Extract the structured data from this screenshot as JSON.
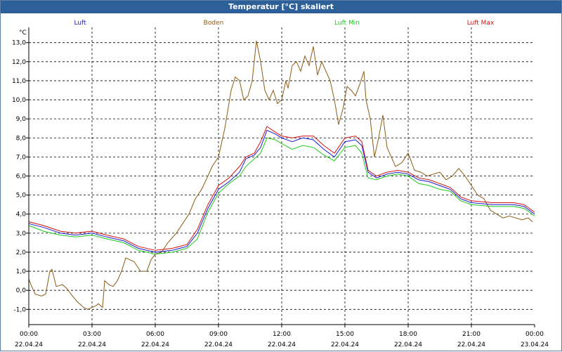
{
  "window": {
    "title": "Temperatur [°C] skaliert"
  },
  "chart_data": {
    "type": "line",
    "title": "Temperatur [°C] skaliert",
    "ylabel": "°C",
    "xlim": [
      0,
      24
    ],
    "ylim": [
      -1.8,
      13.8
    ],
    "y_ticks": [
      "-1,0",
      "0,0",
      "1,0",
      "2,0",
      "3,0",
      "4,0",
      "5,0",
      "6,0",
      "7,0",
      "8,0",
      "9,0",
      "10,0",
      "11,0",
      "12,0",
      "13,0"
    ],
    "y_tick_values": [
      -1,
      0,
      1,
      2,
      3,
      4,
      5,
      6,
      7,
      8,
      9,
      10,
      11,
      12,
      13
    ],
    "x_ticks": [
      {
        "time": "00:00",
        "date": "22.04.24"
      },
      {
        "time": "03:00",
        "date": "22.04.24"
      },
      {
        "time": "06:00",
        "date": "22.04.24"
      },
      {
        "time": "09:00",
        "date": "22.04.24"
      },
      {
        "time": "12:00",
        "date": "22.04.24"
      },
      {
        "time": "15:00",
        "date": "22.04.24"
      },
      {
        "time": "18:00",
        "date": "22.04.24"
      },
      {
        "time": "21:00",
        "date": "22.04.24"
      },
      {
        "time": "00:00",
        "date": "23.04.24"
      }
    ],
    "x_tick_values": [
      0,
      3,
      6,
      9,
      12,
      15,
      18,
      21,
      24
    ],
    "grid": true,
    "legend_position": "top",
    "series": [
      {
        "name": "Boden",
        "color": "#8b5a14",
        "x": [
          0,
          0.1,
          0.3,
          0.6,
          0.8,
          1.0,
          1.1,
          1.3,
          1.6,
          1.8,
          2.0,
          2.3,
          2.6,
          2.8,
          3.0,
          3.2,
          3.3,
          3.5,
          3.6,
          3.8,
          4.0,
          4.2,
          4.4,
          4.6,
          5.0,
          5.3,
          5.6,
          5.8,
          6.0,
          6.3,
          6.6,
          7.0,
          7.3,
          7.6,
          7.9,
          8.2,
          8.5,
          8.7,
          9.0,
          9.3,
          9.6,
          9.8,
          10.0,
          10.2,
          10.4,
          10.6,
          10.8,
          11.0,
          11.2,
          11.4,
          11.6,
          11.8,
          12.0,
          12.2,
          12.3,
          12.5,
          12.7,
          12.9,
          13.1,
          13.3,
          13.5,
          13.7,
          13.9,
          14.1,
          14.3,
          14.5,
          14.7,
          14.9,
          15.1,
          15.3,
          15.5,
          15.7,
          15.9,
          16.0,
          16.2,
          16.4,
          16.6,
          16.8,
          17.0,
          17.2,
          17.4,
          17.7,
          18.0,
          18.3,
          18.6,
          18.9,
          19.2,
          19.5,
          19.8,
          20.1,
          20.4,
          20.7,
          21.0,
          21.3,
          21.6,
          21.9,
          22.2,
          22.5,
          22.8,
          23.1,
          23.4,
          23.7,
          23.9
        ],
        "y": [
          0.6,
          0.3,
          -0.2,
          -0.3,
          -0.2,
          1.0,
          1.1,
          0.2,
          0.3,
          0.1,
          -0.2,
          -0.6,
          -0.9,
          -1.0,
          -0.9,
          -0.8,
          -0.7,
          -0.9,
          0.5,
          0.3,
          0.2,
          0.5,
          1.0,
          1.7,
          1.5,
          1.0,
          1.0,
          1.6,
          1.9,
          2.0,
          2.5,
          3.0,
          3.5,
          4.0,
          4.8,
          5.3,
          6.0,
          6.5,
          7.0,
          8.5,
          10.5,
          11.2,
          11.0,
          10.0,
          10.2,
          11.0,
          13.1,
          12.0,
          10.5,
          10.0,
          10.5,
          9.8,
          10.0,
          11.0,
          10.6,
          11.8,
          12.0,
          11.5,
          12.3,
          11.8,
          12.8,
          11.3,
          12.0,
          11.5,
          11.0,
          10.0,
          8.7,
          9.5,
          10.7,
          10.5,
          10.2,
          10.8,
          11.5,
          10.0,
          9.0,
          7.0,
          8.0,
          9.2,
          7.5,
          7.0,
          6.5,
          6.7,
          7.2,
          6.3,
          6.2,
          6.0,
          6.1,
          6.2,
          5.8,
          6.0,
          6.4,
          6.0,
          5.5,
          5.0,
          4.8,
          4.2,
          4.0,
          3.8,
          3.9,
          3.8,
          3.7,
          3.8,
          3.6
        ]
      },
      {
        "name": "Luft",
        "color": "#1c1cd6",
        "x": [
          0,
          0.7,
          1.5,
          2.2,
          3.0,
          3.7,
          4.5,
          5.2,
          6.0,
          6.8,
          7.5,
          8.0,
          8.5,
          9.0,
          9.5,
          10.0,
          10.3,
          10.7,
          11.0,
          11.3,
          11.7,
          12.0,
          12.5,
          13.0,
          13.5,
          14.0,
          14.5,
          15.0,
          15.5,
          15.8,
          16.1,
          16.5,
          17.0,
          17.5,
          18.0,
          18.5,
          19.0,
          19.5,
          20.0,
          20.5,
          21.0,
          22.0,
          23.0,
          23.5,
          24.0
        ],
        "y": [
          3.5,
          3.3,
          3.0,
          2.9,
          3.0,
          2.8,
          2.6,
          2.2,
          2.0,
          2.1,
          2.3,
          3.0,
          4.3,
          5.3,
          5.7,
          6.2,
          6.9,
          7.1,
          7.5,
          8.4,
          8.2,
          8.0,
          7.8,
          8.0,
          7.9,
          7.4,
          7.0,
          7.8,
          7.9,
          7.6,
          6.2,
          5.9,
          6.1,
          6.2,
          6.1,
          5.8,
          5.7,
          5.5,
          5.3,
          4.8,
          4.6,
          4.5,
          4.5,
          4.4,
          4.0
        ]
      },
      {
        "name": "Luft Min",
        "color": "#1dcb1d",
        "x": [
          0,
          0.7,
          1.5,
          2.2,
          3.0,
          3.7,
          4.5,
          5.2,
          6.0,
          6.8,
          7.5,
          8.0,
          8.5,
          9.0,
          9.5,
          10.0,
          10.3,
          10.7,
          11.0,
          11.3,
          11.7,
          12.0,
          12.5,
          13.0,
          13.5,
          14.0,
          14.5,
          15.0,
          15.5,
          15.8,
          16.1,
          16.5,
          17.0,
          17.5,
          18.0,
          18.5,
          19.0,
          19.5,
          20.0,
          20.5,
          21.0,
          22.0,
          23.0,
          23.5,
          24.0
        ],
        "y": [
          3.4,
          3.1,
          2.9,
          2.8,
          2.9,
          2.7,
          2.5,
          2.1,
          1.9,
          2.0,
          2.2,
          2.7,
          4.1,
          5.1,
          5.6,
          6.0,
          6.5,
          6.9,
          7.2,
          8.0,
          7.9,
          7.7,
          7.4,
          7.6,
          7.5,
          7.1,
          6.8,
          7.5,
          7.6,
          7.2,
          5.9,
          5.8,
          6.0,
          6.1,
          6.0,
          5.6,
          5.5,
          5.3,
          5.2,
          4.7,
          4.5,
          4.4,
          4.4,
          4.3,
          3.9
        ]
      },
      {
        "name": "Luft Max",
        "color": "#d01414",
        "x": [
          0,
          0.7,
          1.5,
          2.2,
          3.0,
          3.7,
          4.5,
          5.2,
          6.0,
          6.8,
          7.5,
          8.0,
          8.5,
          9.0,
          9.5,
          10.0,
          10.3,
          10.7,
          11.0,
          11.3,
          11.7,
          12.0,
          12.5,
          13.0,
          13.5,
          14.0,
          14.5,
          15.0,
          15.5,
          15.8,
          16.1,
          16.5,
          17.0,
          17.5,
          18.0,
          18.5,
          19.0,
          19.5,
          20.0,
          20.5,
          21.0,
          22.0,
          23.0,
          23.5,
          24.0
        ],
        "y": [
          3.6,
          3.4,
          3.1,
          3.0,
          3.1,
          2.9,
          2.7,
          2.3,
          2.1,
          2.2,
          2.4,
          3.2,
          4.5,
          5.5,
          5.9,
          6.5,
          7.0,
          7.2,
          7.8,
          8.6,
          8.3,
          8.1,
          8.0,
          8.1,
          8.1,
          7.6,
          7.2,
          8.0,
          8.1,
          7.8,
          6.3,
          6.0,
          6.2,
          6.3,
          6.2,
          5.9,
          5.8,
          5.6,
          5.4,
          4.9,
          4.7,
          4.6,
          4.6,
          4.5,
          4.1
        ]
      }
    ]
  }
}
